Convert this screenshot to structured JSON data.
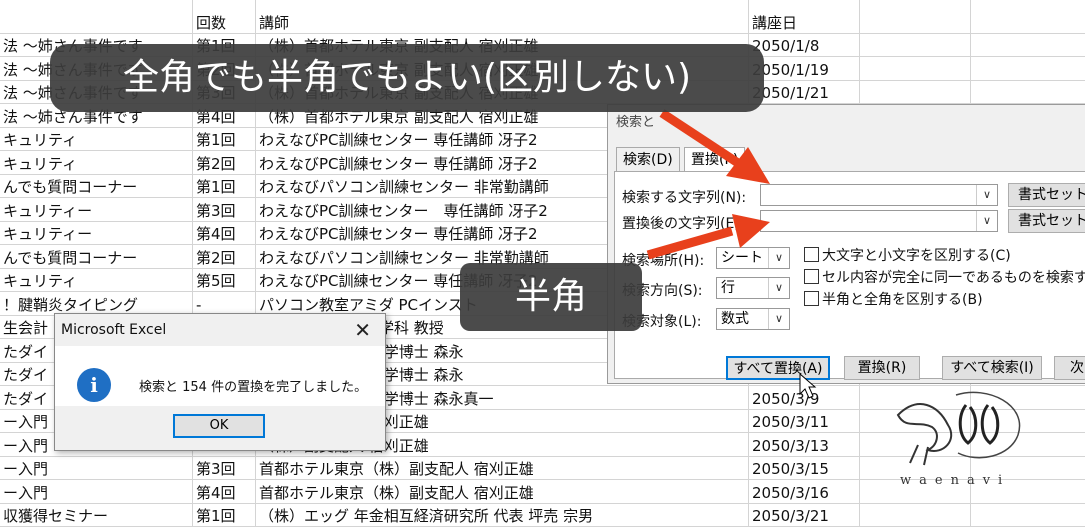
{
  "sheet": {
    "headers": {
      "b": "回数",
      "c": "講師",
      "d": "講座日"
    },
    "rows": [
      {
        "a": "法 ～姉さん事件です",
        "b": "第1回",
        "c": "（株）首都ホテル東京 副支配人 宿刈正雄",
        "d": "2050/1/8"
      },
      {
        "a": "法 ～姉さん事件です",
        "b": "第2回",
        "c": "（株）首都ホテル東京 副支配人 宿刈正雄",
        "d": "2050/1/19"
      },
      {
        "a": "法 ～姉さん事件です",
        "b": "第3回",
        "c": "（株）首都ホテル東京 副支配人 宿刈正雄",
        "d": "2050/1/21"
      },
      {
        "a": "法 ～姉さん事件です",
        "b": "第4回",
        "c": "（株）首都ホテル東京 副支配人 宿刈正雄",
        "d": ""
      },
      {
        "a": "キュリティ",
        "b": "第1回",
        "c": "わえなびPC訓練センター 専任講師 冴子2",
        "d": ""
      },
      {
        "a": "キュリティ",
        "b": "第2回",
        "c": "わえなびPC訓練センター 専任講師 冴子2",
        "d": ""
      },
      {
        "a": "んでも質問コーナー",
        "b": "第1回",
        "c": "わえなびパソコン訓練センター 非常勤講師",
        "d": ""
      },
      {
        "a": "キュリティー",
        "b": "第3回",
        "c": "わえなびPC訓練センター　専任講師 冴子2",
        "d": ""
      },
      {
        "a": "キュリティー",
        "b": "第4回",
        "c": "わえなびPC訓練センター 専任講師 冴子2",
        "d": ""
      },
      {
        "a": "んでも質問コーナー",
        "b": "第2回",
        "c": "わえなびパソコン訓練センター 非常勤講師",
        "d": ""
      },
      {
        "a": "キュリティ",
        "b": "第5回",
        "c": "わえなびPC訓練センター 専任講師 冴子2",
        "d": ""
      },
      {
        "a": "！腱鞘炎タイピング",
        "b": "-",
        "c": "パソコン教室アミダ PCインスト",
        "d": ""
      },
      {
        "a": "生会計",
        "b": "",
        "c": "学園女子大学経営学科 教授",
        "d": ""
      },
      {
        "a": "たダイ",
        "b": "",
        "c": "金メダリスト 体育学博士 森永",
        "d": ""
      },
      {
        "a": "たダイ",
        "b": "",
        "c": "金メダリスト 体育学博士 森永",
        "d": ""
      },
      {
        "a": "たダイ",
        "b": "",
        "c": "金メダリスト 体育学博士 森永真一",
        "d": "2050/3/9"
      },
      {
        "a": "ー入門",
        "b": "",
        "c": "（株）副支配人 宿刈正雄",
        "d": "2050/3/11"
      },
      {
        "a": "ー入門",
        "b": "",
        "c": "（株）副支配人 宿刈正雄",
        "d": "2050/3/13"
      },
      {
        "a": "ー入門",
        "b": "第3回",
        "c": "首都ホテル東京（株）副支配人 宿刈正雄",
        "d": "2050/3/15"
      },
      {
        "a": "ー入門",
        "b": "第4回",
        "c": "首都ホテル東京（株）副支配人 宿刈正雄",
        "d": "2050/3/16"
      },
      {
        "a": "収獲得セミナー",
        "b": "第1回",
        "c": "（株）エッグ 年金相互経済研究所 代表 坪売 宗男",
        "d": "2050/3/21"
      }
    ]
  },
  "captions": {
    "top": "全角でも半角でもよい(区別しない)",
    "middle": "半角"
  },
  "find_replace": {
    "title": "検索と",
    "tabs": [
      "検索(D)",
      "置換(P)"
    ],
    "find_label": "検索する文字列(N):",
    "replace_label": "置換後の文字列(E):",
    "format_button": "書式セット",
    "format_button2": "書式セット",
    "search_label": "検索場所(H):",
    "search_value": "シート",
    "direction_label": "検索方向(S):",
    "direction_value": "行",
    "lookin_label": "検索対象(L):",
    "lookin_value": "数式",
    "option1": "大文字と小文字を区別する(C)",
    "option2": "セル内容が完全に同一であるものを検索する",
    "option3": "半角と全角を区別する(B)",
    "btn_replace_all": "すべて置換(A)",
    "btn_replace": "置換(R)",
    "btn_find_all": "すべて検索(I)",
    "btn_next": "次を"
  },
  "message_box": {
    "title": "Microsoft Excel",
    "message": "検索と 154 件の置換を完了しました。",
    "ok": "OK"
  },
  "logo": {
    "text": "waenavi"
  },
  "colors": {
    "arrow": "#e8401c",
    "caption_bg": "#3c3c3c",
    "info": "#1f6fc4"
  }
}
